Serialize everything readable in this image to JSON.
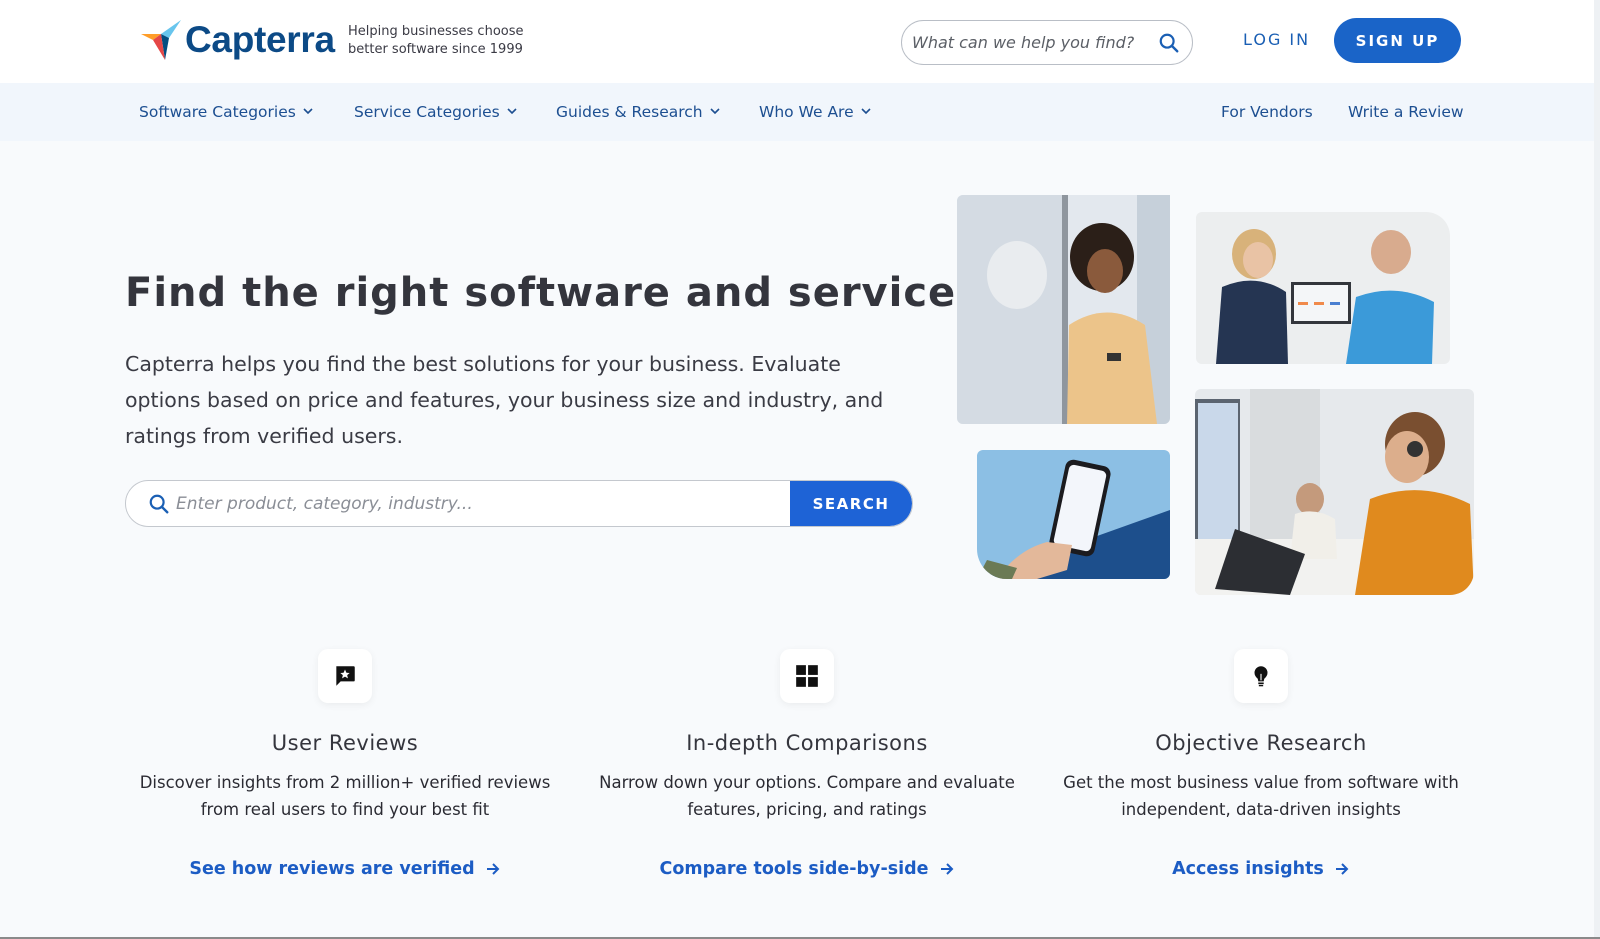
{
  "header": {
    "logo_text": "Capterra",
    "tagline_line1": "Helping businesses choose",
    "tagline_line2": "better software since 1999",
    "search_placeholder": "What can we help you find?",
    "search_icon": "search-icon",
    "login_label": "LOG IN",
    "signup_label": "SIGN UP"
  },
  "nav": {
    "items": [
      {
        "label": "Software Categories",
        "icon": "chevron-down-icon"
      },
      {
        "label": "Service Categories",
        "icon": "chevron-down-icon"
      },
      {
        "label": "Guides & Research",
        "icon": "chevron-down-icon"
      },
      {
        "label": "Who We Are",
        "icon": "chevron-down-icon"
      }
    ],
    "right_items": [
      {
        "label": "For Vendors"
      },
      {
        "label": "Write a Review"
      }
    ]
  },
  "hero": {
    "title": "Find the right software and services",
    "description": "Capterra helps you find the best solutions for your business. Evaluate options based on price and features, your business size and industry, and ratings from verified users.",
    "search_placeholder": "Enter product, category, industry...",
    "search_button": "SEARCH",
    "images": [
      {
        "alt": "Woman smiling at phone by window"
      },
      {
        "alt": "Two colleagues discussing at laptop"
      },
      {
        "alt": "Hand holding phone showing Capterra reviews"
      },
      {
        "alt": "Man with headset working at laptop"
      }
    ]
  },
  "features": [
    {
      "icon": "review-star-icon",
      "title": "User Reviews",
      "description": "Discover insights from 2 million+ verified reviews from real users to find your best fit",
      "link": "See how reviews are verified"
    },
    {
      "icon": "grid-icon",
      "title": "In-depth Comparisons",
      "description": "Narrow down your options. Compare and evaluate features, pricing, and ratings",
      "link": "Compare tools side-by-side"
    },
    {
      "icon": "lightbulb-icon",
      "title": "Objective Research",
      "description": "Get the most business value from software with independent, data-driven insights",
      "link": "Access insights"
    }
  ],
  "colors": {
    "brand_dark_blue": "#0c4a86",
    "primary_button": "#1a64c8",
    "link_blue": "#1c5cc4",
    "nav_bg": "#f1f6fc",
    "page_bg": "#f8fafc"
  }
}
